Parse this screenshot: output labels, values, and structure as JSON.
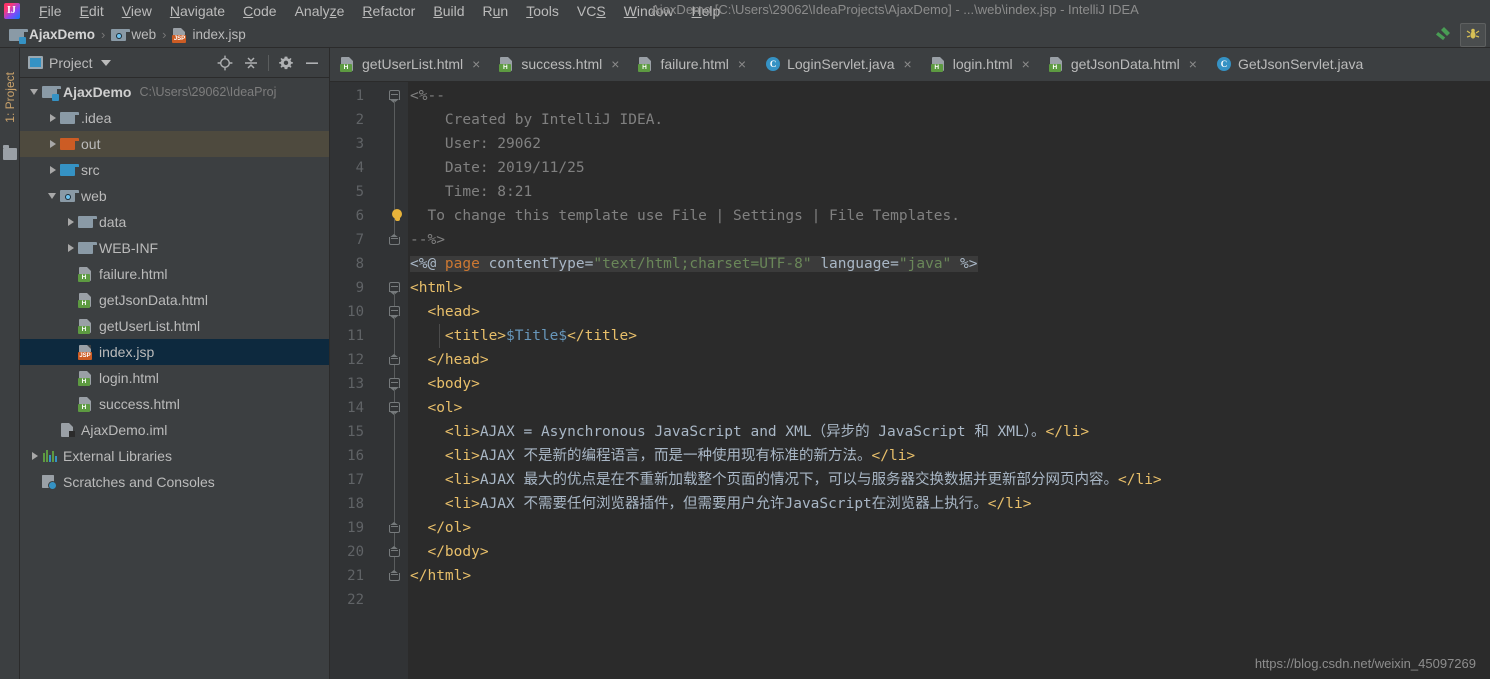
{
  "window": {
    "title": "AjaxDemo [C:\\Users\\29062\\IdeaProjects\\AjaxDemo] - ...\\web\\index.jsp - IntelliJ IDEA"
  },
  "menubar": {
    "items": [
      {
        "label": "File",
        "mnemonic": "F"
      },
      {
        "label": "Edit",
        "mnemonic": "E"
      },
      {
        "label": "View",
        "mnemonic": "V"
      },
      {
        "label": "Navigate",
        "mnemonic": "N"
      },
      {
        "label": "Code",
        "mnemonic": "C"
      },
      {
        "label": "Analyze",
        "mnemonic": "z"
      },
      {
        "label": "Refactor",
        "mnemonic": "R"
      },
      {
        "label": "Build",
        "mnemonic": "B"
      },
      {
        "label": "Run",
        "mnemonic": "u"
      },
      {
        "label": "Tools",
        "mnemonic": "T"
      },
      {
        "label": "VCS",
        "mnemonic": "S"
      },
      {
        "label": "Window",
        "mnemonic": "W"
      },
      {
        "label": "Help",
        "mnemonic": "H"
      }
    ]
  },
  "breadcrumb": {
    "separator": "›",
    "items": [
      {
        "label": "AjaxDemo",
        "icon": "module-folder-icon"
      },
      {
        "label": "web",
        "icon": "web-folder-icon"
      },
      {
        "label": "index.jsp",
        "icon": "jsp-file-icon"
      }
    ]
  },
  "navbar_actions": [
    {
      "name": "build-hammer-icon",
      "label": "Build"
    },
    {
      "name": "run-ant-icon",
      "label": "Ant Build"
    }
  ],
  "tool_strip": {
    "project_tab": "1: Project"
  },
  "project_panel": {
    "title": "Project",
    "actions": [
      {
        "name": "locate-icon",
        "label": "Select Opened File"
      },
      {
        "name": "collapse-all-icon",
        "label": "Collapse All"
      },
      {
        "name": "settings-gear-icon",
        "label": "Settings"
      },
      {
        "name": "hide-minimize-icon",
        "label": "Hide"
      }
    ],
    "tree": [
      {
        "label": "AjaxDemo",
        "sub": "C:\\Users\\29062\\IdeaProj",
        "indent": 0,
        "arrow": "down",
        "icon": "module-folder-icon",
        "bold": true,
        "state": "normal"
      },
      {
        "label": ".idea",
        "sub": "",
        "indent": 1,
        "arrow": "right",
        "icon": "folder-icon",
        "bold": false,
        "state": "normal"
      },
      {
        "label": "out",
        "sub": "",
        "indent": 1,
        "arrow": "right",
        "icon": "folder-orange-icon",
        "bold": false,
        "state": "marked"
      },
      {
        "label": "src",
        "sub": "",
        "indent": 1,
        "arrow": "right",
        "icon": "folder-blue-icon",
        "bold": false,
        "state": "normal"
      },
      {
        "label": "web",
        "sub": "",
        "indent": 1,
        "arrow": "down",
        "icon": "web-folder-icon",
        "bold": false,
        "state": "normal"
      },
      {
        "label": "data",
        "sub": "",
        "indent": 2,
        "arrow": "right",
        "icon": "folder-icon",
        "bold": false,
        "state": "normal"
      },
      {
        "label": "WEB-INF",
        "sub": "",
        "indent": 2,
        "arrow": "right",
        "icon": "folder-icon",
        "bold": false,
        "state": "normal"
      },
      {
        "label": "failure.html",
        "sub": "",
        "indent": 2,
        "arrow": "none",
        "icon": "html-file-icon",
        "bold": false,
        "state": "normal"
      },
      {
        "label": "getJsonData.html",
        "sub": "",
        "indent": 2,
        "arrow": "none",
        "icon": "html-file-icon",
        "bold": false,
        "state": "normal"
      },
      {
        "label": "getUserList.html",
        "sub": "",
        "indent": 2,
        "arrow": "none",
        "icon": "html-file-icon",
        "bold": false,
        "state": "normal"
      },
      {
        "label": "index.jsp",
        "sub": "",
        "indent": 2,
        "arrow": "none",
        "icon": "jsp-file-icon",
        "bold": false,
        "state": "selected"
      },
      {
        "label": "login.html",
        "sub": "",
        "indent": 2,
        "arrow": "none",
        "icon": "html-file-icon",
        "bold": false,
        "state": "normal"
      },
      {
        "label": "success.html",
        "sub": "",
        "indent": 2,
        "arrow": "none",
        "icon": "html-file-icon",
        "bold": false,
        "state": "normal"
      },
      {
        "label": "AjaxDemo.iml",
        "sub": "",
        "indent": 1,
        "arrow": "none",
        "icon": "iml-file-icon",
        "bold": false,
        "state": "normal"
      },
      {
        "label": "External Libraries",
        "sub": "",
        "indent": 0,
        "arrow": "right",
        "icon": "libraries-icon",
        "bold": false,
        "state": "normal"
      },
      {
        "label": "Scratches and Consoles",
        "sub": "",
        "indent": 0,
        "arrow": "none",
        "icon": "scratches-icon",
        "bold": false,
        "state": "normal"
      }
    ]
  },
  "editor_tabs": [
    {
      "label": "getUserList.html",
      "icon": "html-file-icon",
      "active": false,
      "close": "×"
    },
    {
      "label": "success.html",
      "icon": "html-file-icon",
      "active": false,
      "close": "×"
    },
    {
      "label": "failure.html",
      "icon": "html-file-icon",
      "active": false,
      "close": "×"
    },
    {
      "label": "LoginServlet.java",
      "icon": "java-class-icon",
      "active": false,
      "close": "×"
    },
    {
      "label": "login.html",
      "icon": "html-file-icon",
      "active": false,
      "close": "×"
    },
    {
      "label": "getJsonData.html",
      "icon": "html-file-icon",
      "active": false,
      "close": "×"
    },
    {
      "label": "GetJsonServlet.java",
      "icon": "java-class-icon",
      "active": false,
      "close": ""
    }
  ],
  "editor": {
    "file": "index.jsp",
    "line_numbers": [
      1,
      2,
      3,
      4,
      5,
      6,
      7,
      8,
      9,
      10,
      11,
      12,
      13,
      14,
      15,
      16,
      17,
      18,
      19,
      20,
      21,
      22
    ],
    "lines": [
      {
        "n": 1,
        "segments": [
          {
            "t": "<%--",
            "c": "cm"
          }
        ]
      },
      {
        "n": 2,
        "segments": [
          {
            "t": "    Created by IntelliJ IDEA.",
            "c": "cm"
          }
        ]
      },
      {
        "n": 3,
        "segments": [
          {
            "t": "    User: 29062",
            "c": "cm"
          }
        ]
      },
      {
        "n": 4,
        "segments": [
          {
            "t": "    Date: 2019/11/25",
            "c": "cm"
          }
        ]
      },
      {
        "n": 5,
        "segments": [
          {
            "t": "    Time: 8:21",
            "c": "cm"
          }
        ]
      },
      {
        "n": 6,
        "segments": [
          {
            "t": "  To change this template use File | Settings | File Templates.",
            "c": "cm"
          }
        ]
      },
      {
        "n": 7,
        "segments": [
          {
            "t": "--%>",
            "c": "cm"
          }
        ]
      },
      {
        "n": 8,
        "segments": [
          {
            "t": "<%@ ",
            "c": "jspdelim",
            "hl": true
          },
          {
            "t": "page ",
            "c": "kw",
            "hl": true
          },
          {
            "t": "contentType=",
            "c": "attr",
            "hl": true
          },
          {
            "t": "\"text/html;charset=UTF-8\"",
            "c": "str",
            "hl": true
          },
          {
            "t": " language=",
            "c": "attr",
            "hl": true
          },
          {
            "t": "\"java\"",
            "c": "str",
            "hl": true
          },
          {
            "t": " %>",
            "c": "jspdelim",
            "hl": true
          }
        ]
      },
      {
        "n": 9,
        "segments": [
          {
            "t": "<html>",
            "c": "tag"
          }
        ]
      },
      {
        "n": 10,
        "segments": [
          {
            "t": "  <head>",
            "c": "tag"
          }
        ]
      },
      {
        "n": 11,
        "segments": [
          {
            "t": "    <title>",
            "c": "tag"
          },
          {
            "t": "$Title$",
            "c": "var"
          },
          {
            "t": "</title>",
            "c": "tag"
          }
        ]
      },
      {
        "n": 12,
        "segments": [
          {
            "t": "  </head>",
            "c": "tag"
          }
        ]
      },
      {
        "n": 13,
        "segments": [
          {
            "t": "  <body>",
            "c": "tag"
          }
        ]
      },
      {
        "n": 14,
        "segments": [
          {
            "t": "  <ol>",
            "c": "tag"
          }
        ]
      },
      {
        "n": 15,
        "segments": [
          {
            "t": "    <li>",
            "c": "tag"
          },
          {
            "t": "AJAX = Asynchronous JavaScript and XML（异步的 JavaScript 和 XML）。",
            "c": "txt"
          },
          {
            "t": "</li>",
            "c": "tag"
          }
        ]
      },
      {
        "n": 16,
        "segments": [
          {
            "t": "    <li>",
            "c": "tag"
          },
          {
            "t": "AJAX 不是新的编程语言，而是一种使用现有标准的新方法。",
            "c": "txt"
          },
          {
            "t": "</li>",
            "c": "tag"
          }
        ]
      },
      {
        "n": 17,
        "segments": [
          {
            "t": "    <li>",
            "c": "tag"
          },
          {
            "t": "AJAX 最大的优点是在不重新加载整个页面的情况下，可以与服务器交换数据并更新部分网页内容。",
            "c": "txt"
          },
          {
            "t": "</li>",
            "c": "tag"
          }
        ]
      },
      {
        "n": 18,
        "segments": [
          {
            "t": "    <li>",
            "c": "tag"
          },
          {
            "t": "AJAX 不需要任何浏览器插件，但需要用户允许JavaScript在浏览器上执行。",
            "c": "txt"
          },
          {
            "t": "</li>",
            "c": "tag"
          }
        ]
      },
      {
        "n": 19,
        "segments": [
          {
            "t": "  </ol>",
            "c": "tag"
          }
        ]
      },
      {
        "n": 20,
        "segments": [
          {
            "t": "  </body>",
            "c": "tag"
          }
        ]
      },
      {
        "n": 21,
        "segments": [
          {
            "t": "</html>",
            "c": "tag"
          }
        ]
      },
      {
        "n": 22,
        "segments": [
          {
            "t": "",
            "c": "txt"
          }
        ]
      }
    ],
    "intention_bulb_line": 6
  },
  "watermark": "https://blog.csdn.net/weixin_45097269",
  "colors": {
    "background": "#3c3f41",
    "editor_background": "#2b2b2b",
    "gutter_background": "#313335",
    "selection_blue": "#0d293e",
    "marked_olive": "#4e4a3e",
    "text": "#bbbbbb",
    "accent_orange": "#cc7832",
    "string_green": "#6a8759",
    "tag_yellow": "#e8bf6a",
    "variable_blue": "#6897bb"
  }
}
